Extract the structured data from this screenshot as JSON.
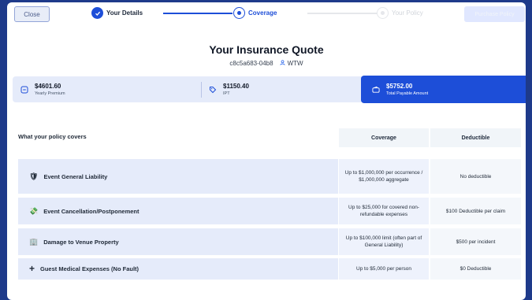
{
  "header": {
    "close_label": "Close",
    "steps": [
      {
        "label": "Your Details",
        "state": "complete"
      },
      {
        "label": "Coverage",
        "state": "current"
      },
      {
        "label": "Your Policy",
        "state": "upcoming"
      }
    ],
    "purchase_label": "Purchase Policy"
  },
  "quote": {
    "title": "Your Insurance Quote",
    "reference": "c8c5a683-04b8",
    "broker": "WTW"
  },
  "summary": {
    "yearly_premium": {
      "value": "$4601.60",
      "label": "Yearly Premium",
      "icon": "minus-box-icon"
    },
    "ipt": {
      "value": "$1150.40",
      "label": "IPT",
      "icon": "tag-icon"
    },
    "total": {
      "value": "$5752.00",
      "label": "Total Payable Amount",
      "icon": "wallet-icon"
    }
  },
  "table": {
    "heading": "What your policy covers",
    "col_coverage": "Coverage",
    "col_deductible": "Deductible",
    "rows": [
      {
        "icon": "shield-icon",
        "glyph": "🛡",
        "name": "Event General Liability",
        "coverage": "Up to $1,000,000 per occurrence / $1,000,000 aggregate",
        "deductible": "No deductible"
      },
      {
        "icon": "money-icon",
        "glyph": "💸",
        "name": "Event Cancellation/Postponement",
        "coverage": "Up to $25,000 for covered non-refundable expenses",
        "deductible": "$100 Deductible per claim"
      },
      {
        "icon": "building-icon",
        "glyph": "🏢",
        "name": "Damage to Venue Property",
        "coverage": "Up to $100,000 limit (often part of General Liability)",
        "deductible": "$500 per incident"
      },
      {
        "icon": "plus-icon",
        "glyph": "+",
        "name": "Guest Medical Expenses (No Fault)",
        "coverage": "Up to $5,000 per person",
        "deductible": "$0 Deductible"
      }
    ]
  },
  "colors": {
    "accent": "#1d4ed8",
    "background": "#1e3a8a",
    "row_bg": "#e5ebfa"
  }
}
